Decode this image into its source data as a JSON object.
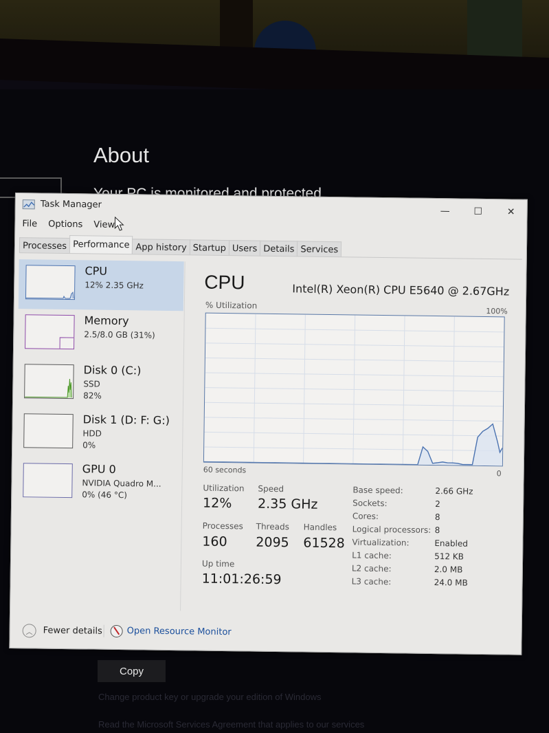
{
  "background": {
    "settings_title": "About",
    "settings_subtitle": "Your PC is monitored and protected",
    "copy_button": "Copy",
    "dim_link_1": "Change product key or upgrade your edition of Windows",
    "dim_link_2": "Read the Microsoft Services Agreement that applies to our services"
  },
  "window": {
    "title": "Task Manager",
    "icons": {
      "app": "task-manager-icon",
      "minimize": "minimize-icon",
      "maximize": "maximize-icon",
      "close": "close-icon"
    },
    "minimize_glyph": "—",
    "maximize_glyph": "☐",
    "close_glyph": "✕"
  },
  "menu": [
    "File",
    "Options",
    "View"
  ],
  "tabs": [
    {
      "label": "Processes",
      "active": false
    },
    {
      "label": "Performance",
      "active": true
    },
    {
      "label": "App history",
      "active": false
    },
    {
      "label": "Startup",
      "active": false
    },
    {
      "label": "Users",
      "active": false
    },
    {
      "label": "Details",
      "active": false
    },
    {
      "label": "Services",
      "active": false
    }
  ],
  "sidebar": [
    {
      "name": "CPU",
      "line2": "12% 2.35 GHz",
      "line3": "",
      "color": "#4a72b0",
      "active": true
    },
    {
      "name": "Memory",
      "line2": "2.5/8.0 GB (31%)",
      "line3": "",
      "color": "#8e4aa8",
      "active": false
    },
    {
      "name": "Disk 0 (C:)",
      "line2": "SSD",
      "line3": "82%",
      "color": "#4f9a2a",
      "active": false
    },
    {
      "name": "Disk 1 (D: F: G:)",
      "line2": "HDD",
      "line3": "0%",
      "color": "#4f9a2a",
      "active": false
    },
    {
      "name": "GPU 0",
      "line2": "NVIDIA Quadro M...",
      "line3": "0% (46 °C)",
      "color": "#6a6aa8",
      "active": false
    }
  ],
  "main": {
    "title": "CPU",
    "model": "Intel(R) Xeon(R) CPU E5640 @ 2.67GHz",
    "graph_label": "% Utilization",
    "graph_max": "100%",
    "graph_x_left": "60 seconds",
    "graph_x_right": "0",
    "stats": {
      "utilization_label": "Utilization",
      "utilization": "12%",
      "speed_label": "Speed",
      "speed": "2.35 GHz",
      "processes_label": "Processes",
      "processes": "160",
      "threads_label": "Threads",
      "threads": "2095",
      "handles_label": "Handles",
      "handles": "61528",
      "uptime_label": "Up time",
      "uptime": "11:01:26:59"
    },
    "specs": [
      {
        "key": "Base speed:",
        "value": "2.66 GHz"
      },
      {
        "key": "Sockets:",
        "value": "2"
      },
      {
        "key": "Cores:",
        "value": "8"
      },
      {
        "key": "Logical processors:",
        "value": "8"
      },
      {
        "key": "Virtualization:",
        "value": "Enabled"
      },
      {
        "key": "L1 cache:",
        "value": "512 KB"
      },
      {
        "key": "L2 cache:",
        "value": "2.0 MB"
      },
      {
        "key": "L3 cache:",
        "value": "24.0 MB"
      }
    ]
  },
  "footer": {
    "fewer_details": "Fewer details",
    "open_resource_monitor": "Open Resource Monitor"
  },
  "chart_data": {
    "type": "area",
    "title": "% Utilization",
    "xlabel": "60 seconds",
    "ylabel": "% Utilization",
    "xlim": [
      60,
      0
    ],
    "ylim": [
      0,
      100
    ],
    "grid": true,
    "x": [
      60,
      17,
      16,
      15,
      14,
      13,
      12,
      11,
      10,
      9,
      8,
      7,
      6,
      5,
      4,
      3,
      2,
      1,
      0.5,
      0
    ],
    "series": [
      {
        "name": "CPU",
        "color": "#4a72b0",
        "values": [
          0,
          0,
          12,
          9,
          1,
          1.5,
          2,
          1.5,
          1.5,
          1.2,
          0.5,
          0.5,
          0.5,
          19,
          23,
          25,
          28,
          16,
          9,
          12
        ]
      }
    ]
  }
}
